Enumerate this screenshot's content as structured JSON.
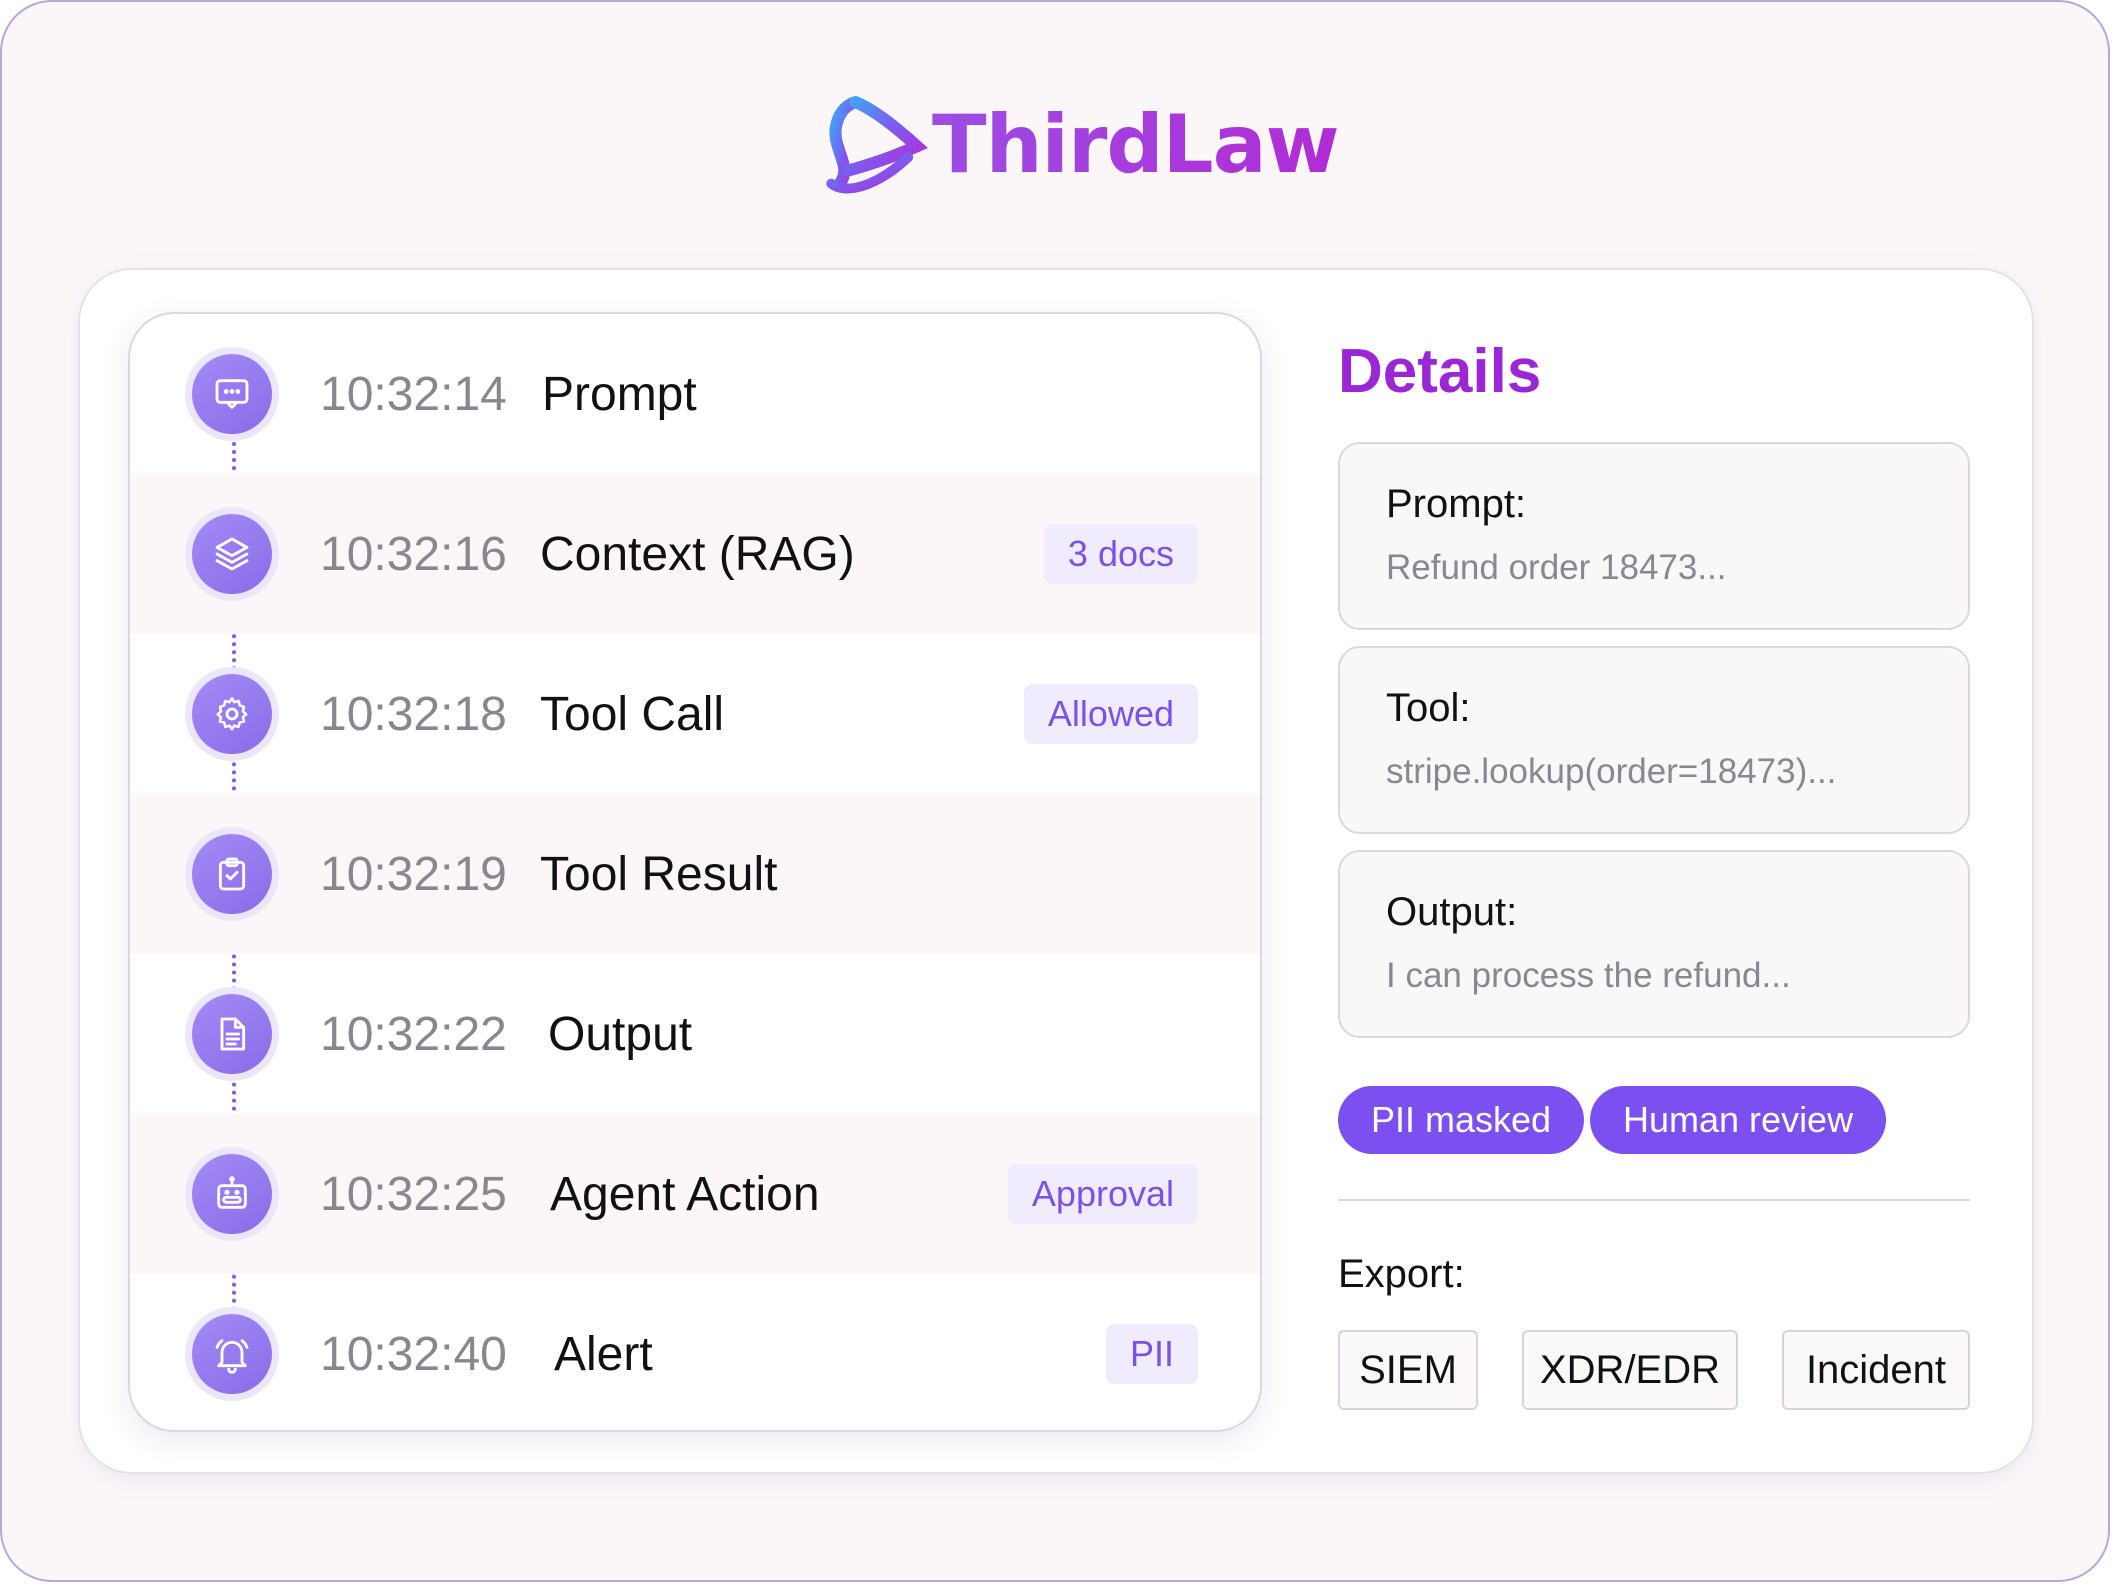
{
  "brand": {
    "name": "ThirdLaw",
    "logo_icon": "thirdlaw-logo-icon"
  },
  "timeline": {
    "events": [
      {
        "time": "10:32:14",
        "label": "Prompt",
        "icon": "message-icon",
        "tag": ""
      },
      {
        "time": "10:32:16",
        "label": "Context (RAG)",
        "icon": "layers-icon",
        "tag": "3 docs"
      },
      {
        "time": "10:32:18",
        "label": "Tool Call",
        "icon": "gear-icon",
        "tag": "Allowed"
      },
      {
        "time": "10:32:19",
        "label": "Tool Result",
        "icon": "clipboard-check-icon",
        "tag": ""
      },
      {
        "time": "10:32:22",
        "label": "Output",
        "icon": "document-icon",
        "tag": ""
      },
      {
        "time": "10:32:25",
        "label": "Agent Action",
        "icon": "robot-icon",
        "tag": "Approval"
      },
      {
        "time": "10:32:40",
        "label": "Alert",
        "icon": "bell-icon",
        "tag": "PII"
      }
    ]
  },
  "details": {
    "title": "Details",
    "prompt": {
      "key": "Prompt:",
      "value": "Refund order 18473..."
    },
    "tool": {
      "key": "Tool:",
      "value": "stripe.lookup(order=18473)..."
    },
    "output": {
      "key": "Output:",
      "value": "I can process the refund..."
    },
    "badges": [
      "PII masked",
      "Human review"
    ],
    "export_label": "Export:",
    "export_targets": [
      "SIEM",
      "XDR/EDR",
      "Incident"
    ]
  },
  "colors": {
    "accent": "#7c4ff0",
    "brand": "#9a26d4",
    "tag_bg": "#f0ecfd",
    "rail": "#7d5ae8"
  }
}
